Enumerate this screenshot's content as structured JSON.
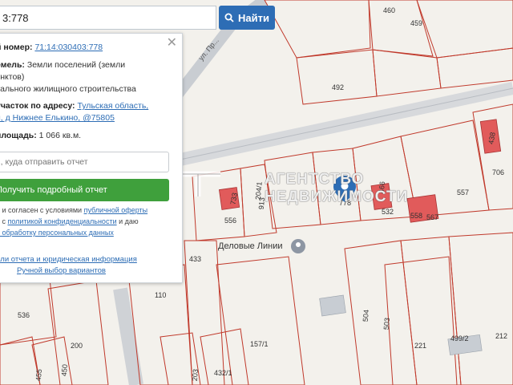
{
  "search": {
    "value": "3:778",
    "button_label": "Найти",
    "partial_header": "...:66:36..."
  },
  "panel": {
    "cadastral_label": "й номер:",
    "cadastral_value": "71:14:030403:778",
    "category_label": "емель:",
    "category_value": "Земли поселений (земли",
    "category_value_2": "унктов)",
    "use_value": "уального жилищного строительства",
    "address_label": "участок по адресу:",
    "address_value": "Тульская область,",
    "address_value_2": "н, д Нижнее Елькино, @75805",
    "area_label": "площадь:",
    "area_value": "1 066 кв.м.",
    "email_placeholder": "il, куда отправить отчет",
    "report_button": "Получить подробный отчет",
    "consent_1a": "н и согласен с условиями ",
    "consent_1b": "публичной оферты",
    "consent_2a": "н с ",
    "consent_2b": "политикой конфиденциальности",
    "consent_2c": " и даю",
    "consent_3a": "а обработку персональных данных",
    "link_details": "али отчета и юридическая информация",
    "link_manual": "Ручной выбор вариантов"
  },
  "map": {
    "street": "ул. Пр...",
    "poi": "Деловые Линии",
    "plots": [
      "460",
      "459",
      "492",
      "438",
      "706",
      "557",
      "532",
      "558",
      "567",
      "556",
      "733",
      "778",
      "504",
      "503",
      "499/2",
      "212",
      "221",
      "157/1",
      "432/1",
      "433",
      "536",
      "200",
      "110",
      "450",
      "455",
      "203",
      "204/1",
      "913",
      "466"
    ]
  },
  "watermark": {
    "line1": "АГЕНТСТВО",
    "line2": "НЕДВИЖИМОСТИ"
  },
  "colors": {
    "accent": "#2d6db5",
    "button_green": "#3fa03c",
    "plot_border": "#c0392b",
    "building": "#e15b5b"
  }
}
